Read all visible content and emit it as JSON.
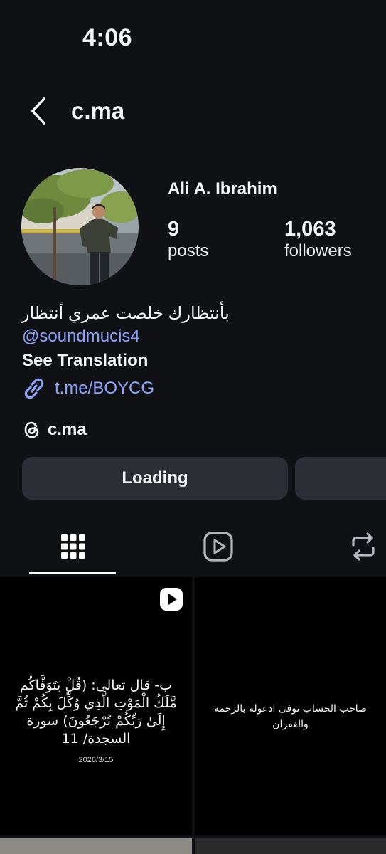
{
  "status_bar": {
    "time": "4:06"
  },
  "header": {
    "username": "c.ma",
    "back_icon": "chevron-left-icon"
  },
  "profile": {
    "display_name": "Ali A. Ibrahim",
    "stats": {
      "posts": {
        "value": "9",
        "label": "posts"
      },
      "followers": {
        "value": "1,063",
        "label": "followers"
      }
    },
    "bio": "بأنتظارك خلصت عمري أنتظار",
    "mention": "@soundmucis4",
    "see_translation": "See Translation",
    "link": {
      "icon": "link-icon",
      "text": "t.me/BOYCG"
    },
    "threads": {
      "icon": "threads-icon",
      "text": "c.ma"
    }
  },
  "actions": {
    "primary_label": "Loading"
  },
  "tabs": [
    {
      "name": "grid",
      "icon": "grid-icon",
      "active": true
    },
    {
      "name": "reels",
      "icon": "reels-icon",
      "active": false
    },
    {
      "name": "reposts",
      "icon": "repost-icon",
      "active": false
    }
  ],
  "posts": [
    {
      "type": "reel",
      "text": "ب- قال تعالى: (قُلْ يَتَوَفَّاكُم مَّلَكُ الْمَوْتِ الَّذِي وُكِّلَ بِكُمْ ثُمَّ إِلَىٰ رَبِّكُمْ تُرْجَعُونَ) سورة السجدة/ 11",
      "date": "2026/3/15"
    },
    {
      "type": "image",
      "text": "صاحب الحساب توفى ادعوله بالرحمه والغفران"
    }
  ],
  "colors": {
    "background": "#0f1115",
    "button": "#2b2e34",
    "link": "#8da4ff",
    "text": "#f4f5f7"
  }
}
